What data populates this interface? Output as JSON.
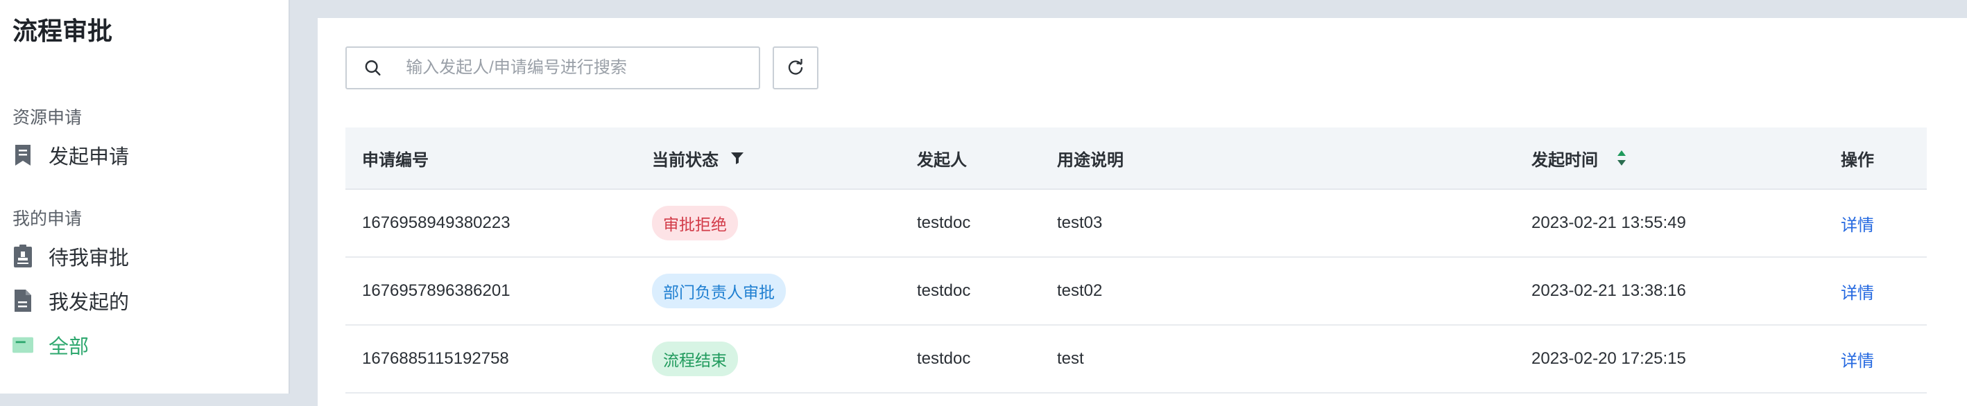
{
  "app_title": "流程审批",
  "sidebar": {
    "group1_title": "资源申请",
    "group1_items": [
      "发起申请"
    ],
    "group2_title": "我的申请",
    "group2_items": [
      "待我审批",
      "我发起的",
      "全部"
    ],
    "active_item": "全部"
  },
  "search": {
    "placeholder": "输入发起人/申请编号进行搜索",
    "value": ""
  },
  "table": {
    "headers": [
      "申请编号",
      "当前状态",
      "发起人",
      "用途说明",
      "发起时间",
      "操作"
    ],
    "rows": [
      {
        "id": "1676958949380223",
        "status": "审批拒绝",
        "status_color": "red",
        "initiator": "testdoc",
        "purpose": "test03",
        "time": "2023-02-21 13:55:49",
        "action": "详情"
      },
      {
        "id": "1676957896386201",
        "status": "部门负责人审批",
        "status_color": "blue",
        "initiator": "testdoc",
        "purpose": "test02",
        "time": "2023-02-21 13:38:16",
        "action": "详情"
      },
      {
        "id": "1676885115192758",
        "status": "流程结束",
        "status_color": "green",
        "initiator": "testdoc",
        "purpose": "test",
        "time": "2023-02-20 17:25:15",
        "action": "详情"
      }
    ]
  },
  "colors": {
    "accent_green": "#2fa86f",
    "link_blue": "#2468e0",
    "reject_red": "#d23b48",
    "process_blue": "#1f7fd1",
    "done_green": "#1f9a5c"
  }
}
